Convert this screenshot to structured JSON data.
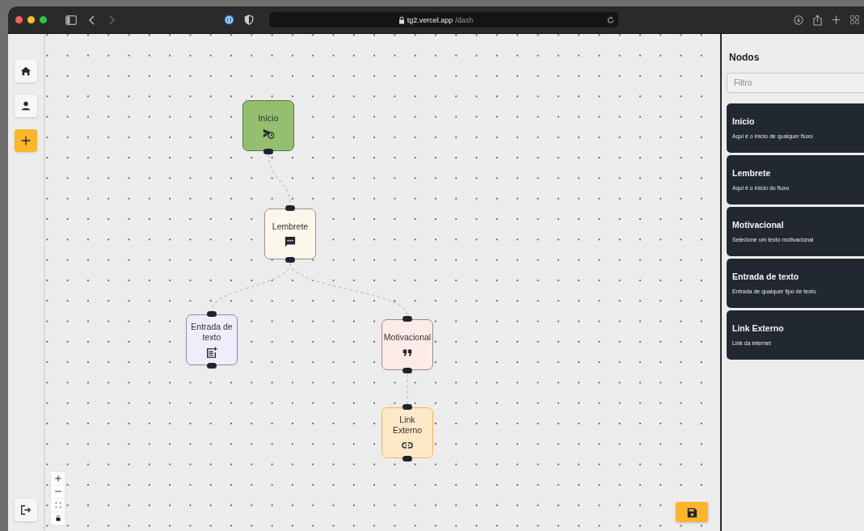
{
  "browser": {
    "url_host": "tg2.vercel.app",
    "url_path": "/dash"
  },
  "sidebar": {
    "buttons": [
      {
        "kind": "home"
      },
      {
        "kind": "user"
      },
      {
        "kind": "add"
      }
    ],
    "bottom_button": {
      "kind": "logout"
    }
  },
  "canvas": {
    "nodes": [
      {
        "label": "Início",
        "kind": "start",
        "color": "#93bf6f"
      },
      {
        "label": "Lembrete",
        "kind": "reminder",
        "color": "#fcf6eb"
      },
      {
        "label": "Entrada de texto",
        "kind": "text_input",
        "color": "#f0ecfa"
      },
      {
        "label": "Motivacional",
        "kind": "quote",
        "color": "#fdebe8"
      },
      {
        "label": "Link Externo",
        "kind": "link",
        "color": "#fee8c8"
      }
    ],
    "zoom_controls": [
      {
        "kind": "zoom_in"
      },
      {
        "kind": "zoom_out"
      },
      {
        "kind": "fit"
      },
      {
        "kind": "lock"
      }
    ],
    "save_button": {
      "kind": "save"
    }
  },
  "panel": {
    "title": "Nodos",
    "filter": {
      "placeholder": "Filtro"
    },
    "items": [
      {
        "title": "Início",
        "description": "Aqui é o início de qualquer fluxo"
      },
      {
        "title": "Lembrete",
        "description": "Aqui é o início do fluxo"
      },
      {
        "title": "Motivacional",
        "description": "Selecione um texto motivacional"
      },
      {
        "title": "Entrada de texto",
        "description": "Entrada de qualquer tipo de texto"
      },
      {
        "title": "Link Externo",
        "description": "Link da internet"
      }
    ]
  }
}
